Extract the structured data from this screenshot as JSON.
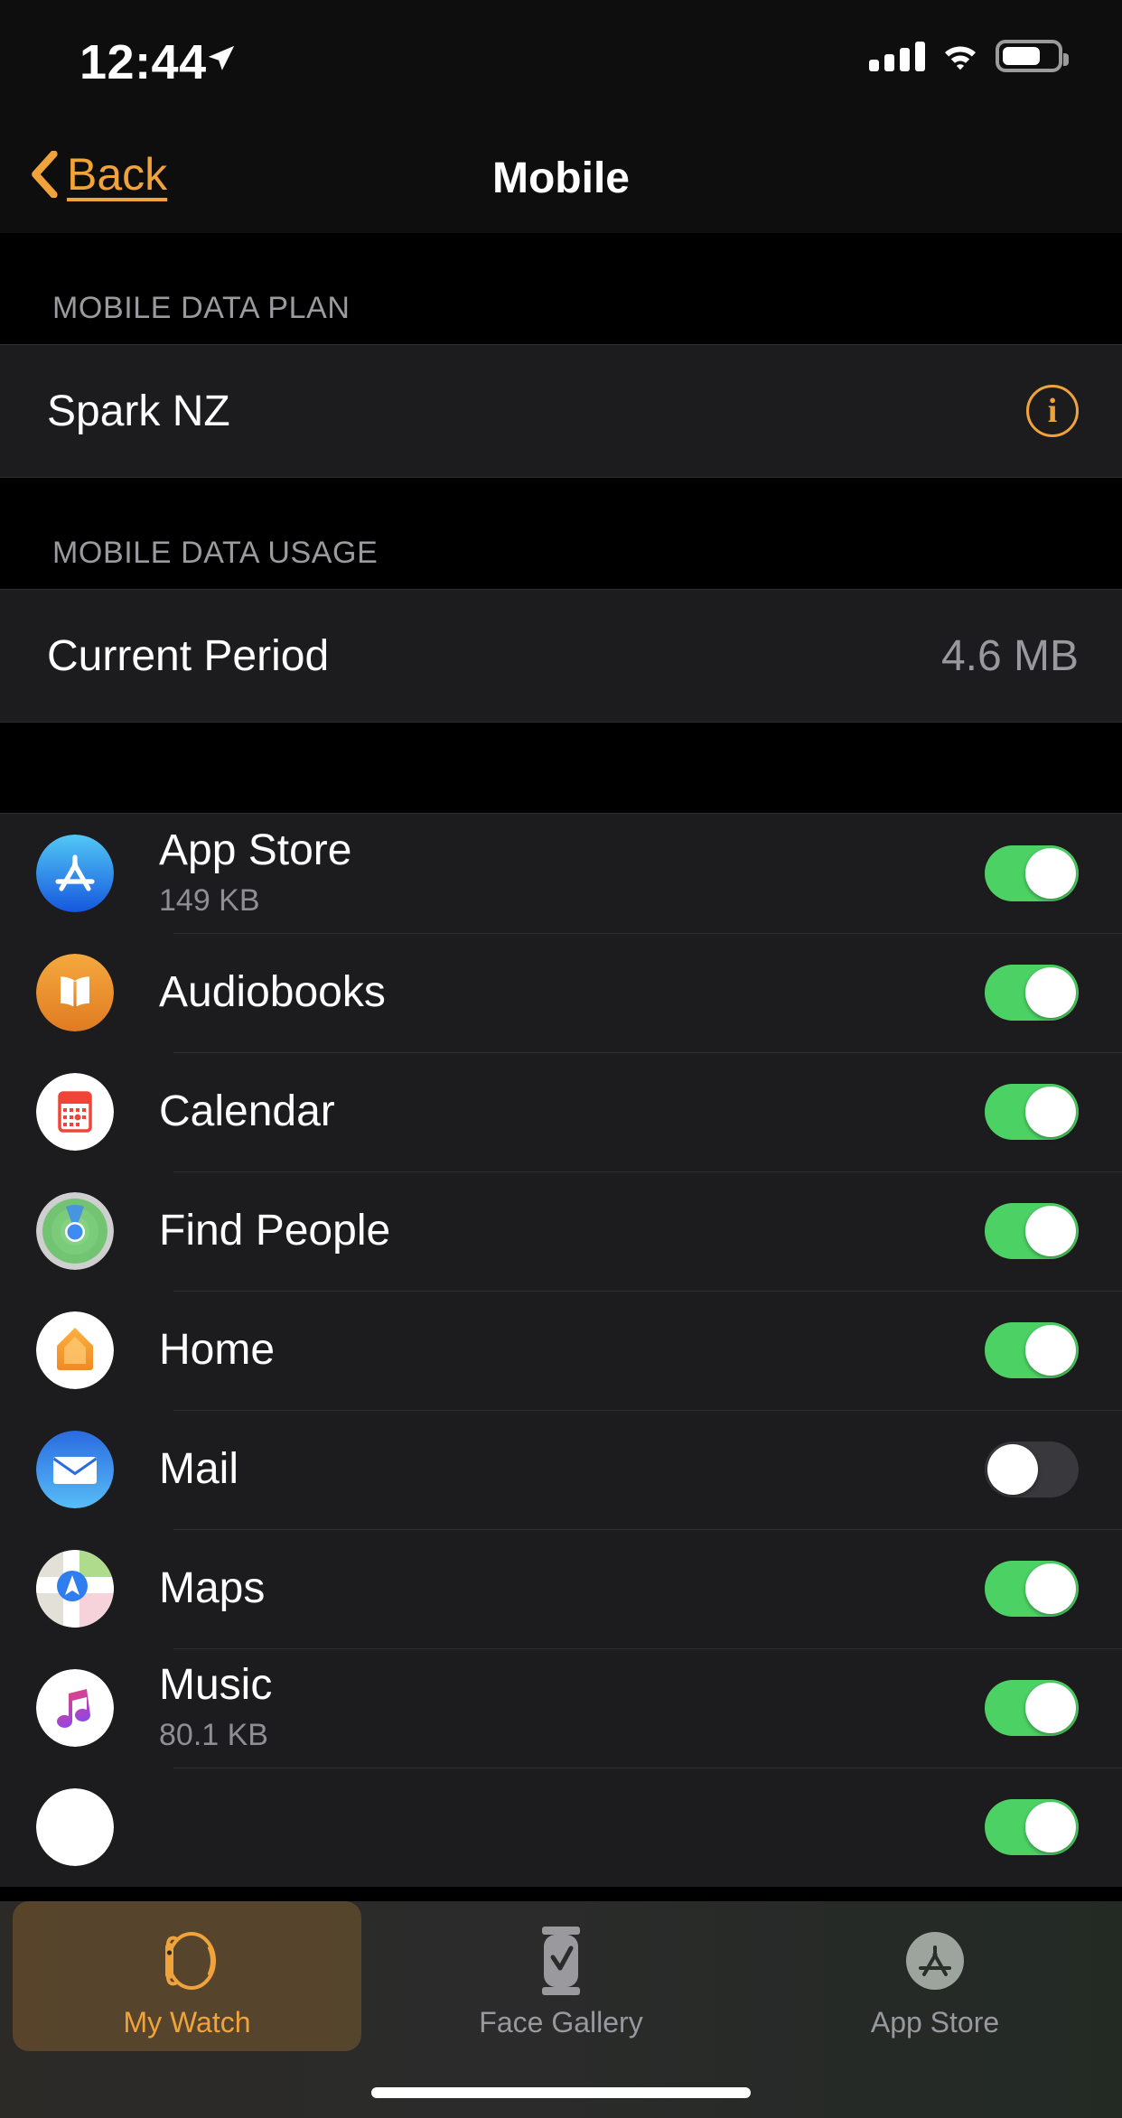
{
  "status_bar": {
    "time": "12:44",
    "location_icon": "location-arrow-icon",
    "signal_icon": "cellular-signal-icon",
    "signal_bars": 4,
    "wifi_icon": "wifi-icon",
    "battery_icon": "battery-icon",
    "battery_percent": 70
  },
  "nav": {
    "back_label": "Back",
    "back_icon": "chevron-left-icon",
    "title": "Mobile"
  },
  "sections": [
    {
      "header": "MOBILE DATA PLAN",
      "rows": [
        {
          "title": "Spark NZ",
          "accessory": "info-circle-icon",
          "info_glyph": "i"
        }
      ]
    },
    {
      "header": "MOBILE DATA USAGE",
      "rows": [
        {
          "title": "Current Period",
          "value": "4.6 MB"
        }
      ]
    }
  ],
  "apps": [
    {
      "name": "App Store",
      "size": "149 KB",
      "icon": "app-store-icon",
      "toggle": "on"
    },
    {
      "name": "Audiobooks",
      "size": "",
      "icon": "audiobooks-icon",
      "toggle": "on"
    },
    {
      "name": "Calendar",
      "size": "",
      "icon": "calendar-icon",
      "toggle": "on"
    },
    {
      "name": "Find People",
      "size": "",
      "icon": "find-people-icon",
      "toggle": "on"
    },
    {
      "name": "Home",
      "size": "",
      "icon": "home-icon",
      "toggle": "on"
    },
    {
      "name": "Mail",
      "size": "",
      "icon": "mail-icon",
      "toggle": "off"
    },
    {
      "name": "Maps",
      "size": "",
      "icon": "maps-icon",
      "toggle": "on"
    },
    {
      "name": "Music",
      "size": "80.1 KB",
      "icon": "music-icon",
      "toggle": "on"
    }
  ],
  "tabs": [
    {
      "label": "My Watch",
      "icon": "watch-icon",
      "active": true
    },
    {
      "label": "Face Gallery",
      "icon": "watch-face-icon",
      "active": false
    },
    {
      "label": "App Store",
      "icon": "app-store-tab-icon",
      "active": false
    }
  ],
  "colors": {
    "accent": "#F0A33A",
    "toggle_on": "#4CD264",
    "toggle_off": "#39393D",
    "row_bg": "#1C1C1E",
    "page_bg": "#000000",
    "secondary_text": "#98989E"
  }
}
